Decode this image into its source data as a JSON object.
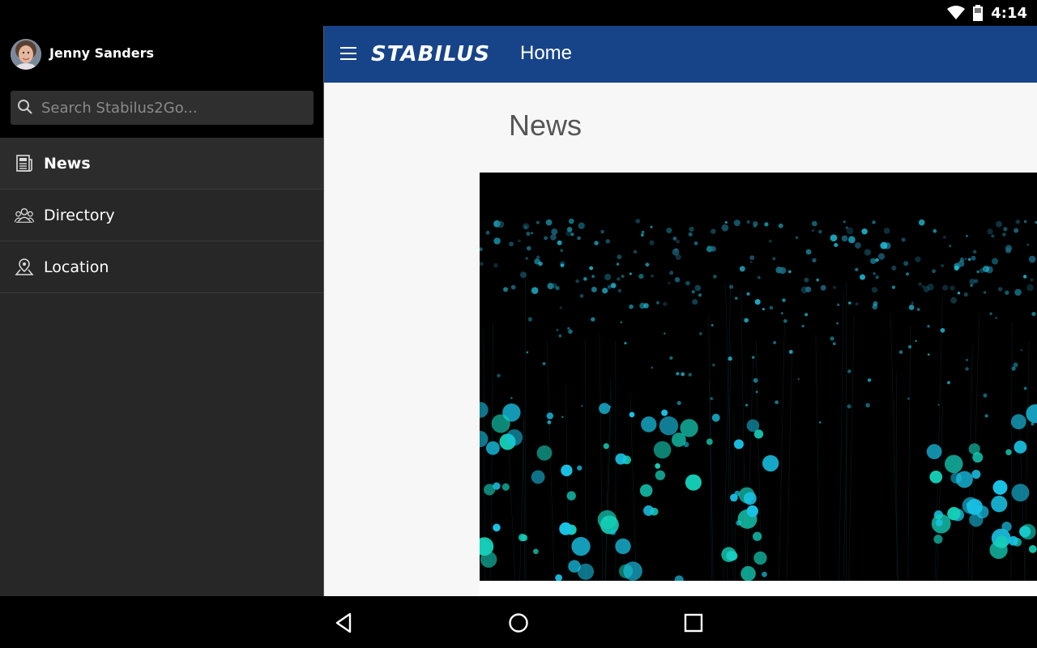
{
  "status_bar": {
    "time": "4:14",
    "icons": [
      "wifi-icon",
      "battery-icon"
    ]
  },
  "sidebar": {
    "user": {
      "name": "Jenny Sanders",
      "avatar": "avatar"
    },
    "search": {
      "placeholder": "Search Stabilus2Go..."
    },
    "items": [
      {
        "label": "News",
        "icon": "newspaper-icon",
        "active": true
      },
      {
        "label": "Directory",
        "icon": "people-icon",
        "active": false
      },
      {
        "label": "Location",
        "icon": "map-pin-icon",
        "active": false
      }
    ]
  },
  "header": {
    "brand": "STABILUS",
    "page": "Home"
  },
  "main": {
    "section_title": "News"
  },
  "colors": {
    "header_bg": "#174489",
    "sidebar_bg": "#272727",
    "accent_dots": "#20c4e0"
  },
  "system_nav": {
    "buttons": [
      "back-icon",
      "home-icon",
      "recents-icon"
    ]
  }
}
